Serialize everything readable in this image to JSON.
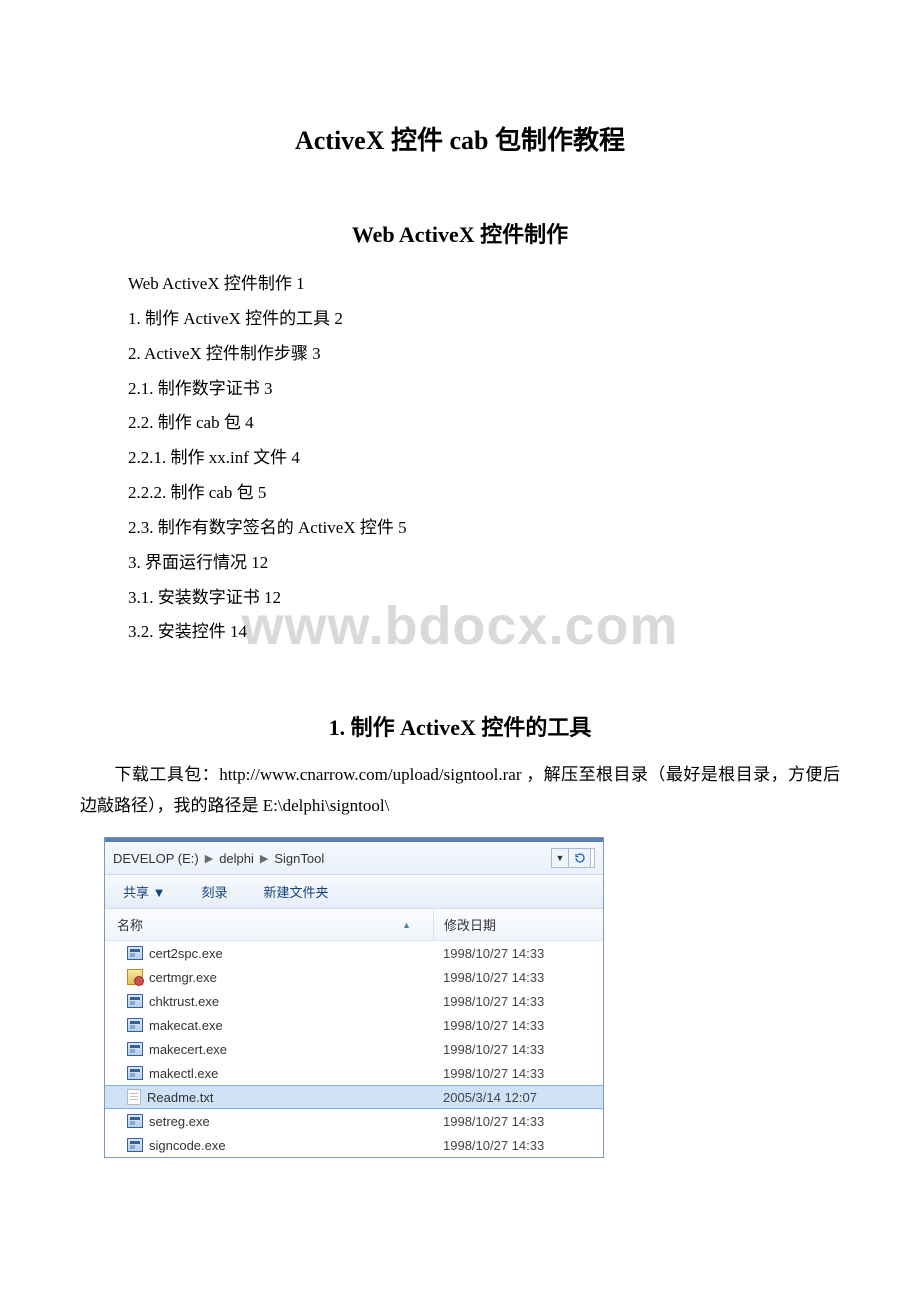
{
  "title": "ActiveX 控件 cab 包制作教程",
  "subtitle": "Web ActiveX 控件制作",
  "watermark": "www.bdocx.com",
  "toc": [
    "Web ActiveX 控件制作 1",
    "1. 制作 ActiveX 控件的工具 2",
    "2. ActiveX 控件制作步骤 3",
    "2.1. 制作数字证书 3",
    "2.2. 制作 cab 包 4",
    "2.2.1. 制作 xx.inf 文件 4",
    "2.2.2. 制作 cab 包 5",
    "2.3. 制作有数字签名的 ActiveX 控件 5",
    "3. 界面运行情况 12",
    "3.1. 安装数字证书 12",
    "3.2. 安装控件 14"
  ],
  "section1": {
    "heading": "1. 制作 ActiveX 控件的工具",
    "body": "下载工具包：http://www.cnarrow.com/upload/signtool.rar ，解压至根目录（最好是根目录，方便后边敲路径），我的路径是 E:\\delphi\\signtool\\"
  },
  "explorer": {
    "breadcrumb": [
      "DEVELOP (E:)",
      "delphi",
      "SignTool"
    ],
    "toolbar": {
      "share": "共享 ▼",
      "burn": "刻录",
      "newfolder": "新建文件夹"
    },
    "columns": {
      "name": "名称",
      "date": "修改日期"
    },
    "files": [
      {
        "icon": "exe",
        "name": "cert2spc.exe",
        "date": "1998/10/27 14:33"
      },
      {
        "icon": "certmgr",
        "name": "certmgr.exe",
        "date": "1998/10/27 14:33"
      },
      {
        "icon": "exe",
        "name": "chktrust.exe",
        "date": "1998/10/27 14:33"
      },
      {
        "icon": "exe",
        "name": "makecat.exe",
        "date": "1998/10/27 14:33"
      },
      {
        "icon": "exe",
        "name": "makecert.exe",
        "date": "1998/10/27 14:33"
      },
      {
        "icon": "exe",
        "name": "makectl.exe",
        "date": "1998/10/27 14:33"
      },
      {
        "icon": "txt",
        "name": "Readme.txt",
        "date": "2005/3/14 12:07",
        "selected": true
      },
      {
        "icon": "exe",
        "name": "setreg.exe",
        "date": "1998/10/27 14:33"
      },
      {
        "icon": "exe",
        "name": "signcode.exe",
        "date": "1998/10/27 14:33"
      }
    ]
  }
}
